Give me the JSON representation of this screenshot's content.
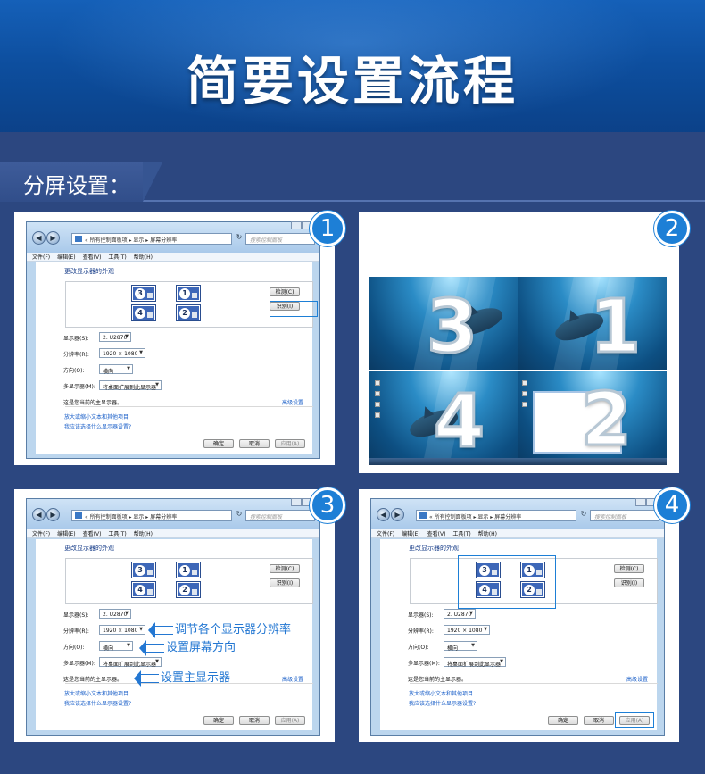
{
  "header": {
    "title": "简要设置流程"
  },
  "section": {
    "label": "分屏设置："
  },
  "window": {
    "address": "« 所有控制面板项 ▸ 显示 ▸ 屏幕分辨率",
    "search_placeholder": "搜索控制面板",
    "menu": [
      "文件(F)",
      "编辑(E)",
      "查看(V)",
      "工具(T)",
      "帮助(H)"
    ],
    "heading": "更改显示器的外观",
    "detect_button": "检测(C)",
    "identify_button": "识别(I)",
    "display_label": "显示器(S):",
    "display_value": "2. U2870",
    "resolution_label": "分辨率(R):",
    "resolution_value": "1920 × 1080",
    "orientation_label": "方向(O):",
    "orientation_value": "横向",
    "multi_label": "多显示器(M):",
    "multi_value": "将桌面扩展到此显示器",
    "primary_text": "这是您当前的主显示器。",
    "advanced_link": "高级设置",
    "link_text_size": "放大或缩小文本和其他项目",
    "link_settings": "我应该选择什么显示器设置?",
    "ok_button": "确定",
    "cancel_button": "取消",
    "apply_button": "应用(A)",
    "monitors": [
      "3",
      "1",
      "4",
      "2"
    ]
  },
  "panels": [
    {
      "badge": "1"
    },
    {
      "badge": "2",
      "screens": [
        "3",
        "1",
        "4",
        "2"
      ]
    },
    {
      "badge": "3",
      "notes": [
        "调节各个显示器分辨率",
        "设置屏幕方向",
        "设置主显示器"
      ]
    },
    {
      "badge": "4"
    }
  ],
  "colors": {
    "accent": "#1d7fd6",
    "note": "#2377d2",
    "background": "#2c4780",
    "header": "#0d4e9e"
  }
}
